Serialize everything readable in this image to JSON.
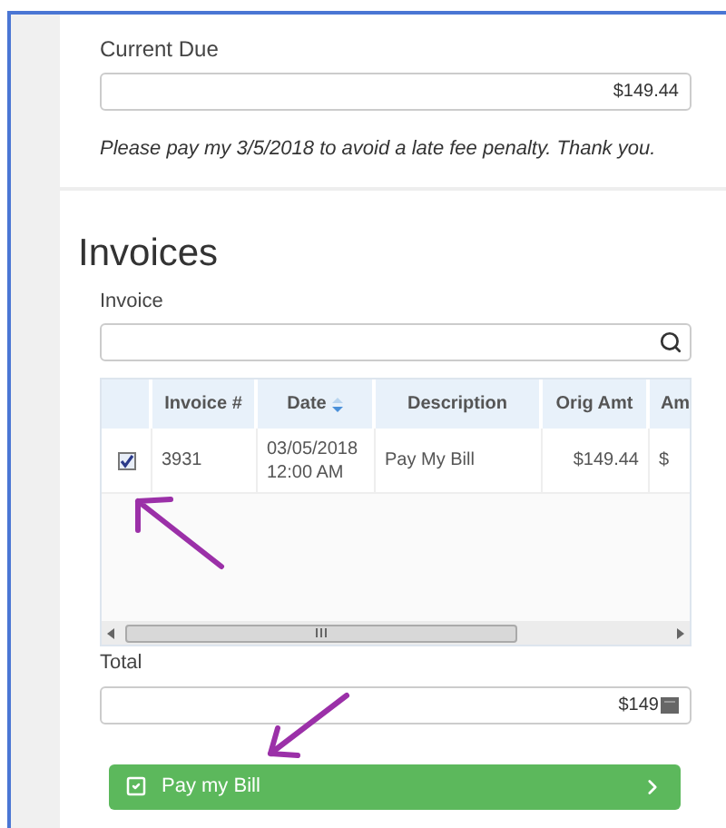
{
  "current_due": {
    "label": "Current Due",
    "value": "$149.44"
  },
  "notice": "Please pay my 3/5/2018 to avoid a late fee penalty. Thank you.",
  "invoices": {
    "title": "Invoices",
    "search": {
      "label": "Invoice"
    },
    "table": {
      "columns": [
        {
          "label": "Invoice #",
          "sorted": false
        },
        {
          "label": "Date",
          "sorted": true
        },
        {
          "label": "Description",
          "sorted": false
        },
        {
          "label": "Orig Amt",
          "sorted": false
        },
        {
          "label": "Am",
          "sorted": false
        }
      ],
      "rows": [
        {
          "checked": true,
          "cells": [
            "3931",
            "03/05/2018 12:00 AM",
            "Pay My Bill",
            "$149.44",
            "$"
          ]
        }
      ]
    },
    "total": {
      "label": "Total",
      "value": "$149"
    }
  },
  "pay_button": {
    "label": "Pay my Bill"
  }
}
